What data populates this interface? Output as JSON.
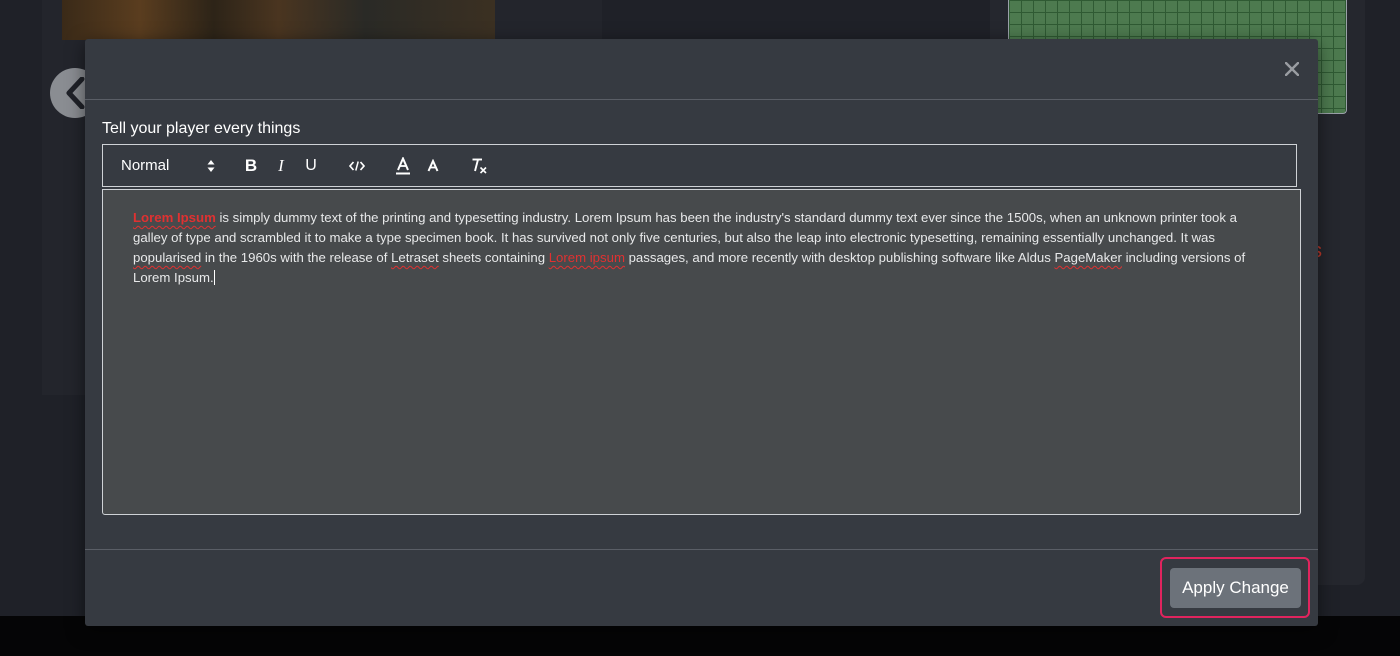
{
  "modal": {
    "field_label": "Tell your player every things",
    "close_symbol": "×"
  },
  "toolbar": {
    "format_select": "Normal",
    "bold": "B",
    "italic": "I",
    "underline": "U",
    "code_icon": "code-icon",
    "color_icon": "text-color-icon",
    "background_icon": "background-color-icon",
    "clean_icon": "clear-format-icon"
  },
  "editor": {
    "segments": {
      "s1": "Lorem Ipsum",
      "s2": " is simply dummy text of the printing and typesetting industry. Lorem Ipsum has been the industry's standard dummy text ever since the 1500s, when an unknown printer took a galley of type and scrambled it to make a type specimen book. It has survived not only five centuries, but also the leap into electronic typesetting, remaining essentially unchanged. It was ",
      "s3": "popularised",
      "s4": " in the 1960s with the release of ",
      "s5": "Letraset",
      "s6": " sheets containing ",
      "s7": "Lorem ipsum",
      "s8": " passages, and more recently with desktop publishing software like Aldus ",
      "s9": "PageMaker",
      "s10": " including versions of Lorem Ipsum."
    }
  },
  "footer": {
    "apply_label": "Apply Change"
  },
  "colors": {
    "modal_bg": "#363a41",
    "editor_bg": "#474a4c",
    "apply_button": "#6c727a",
    "highlight_border": "#e0245e",
    "misspelling": "#e03131"
  }
}
